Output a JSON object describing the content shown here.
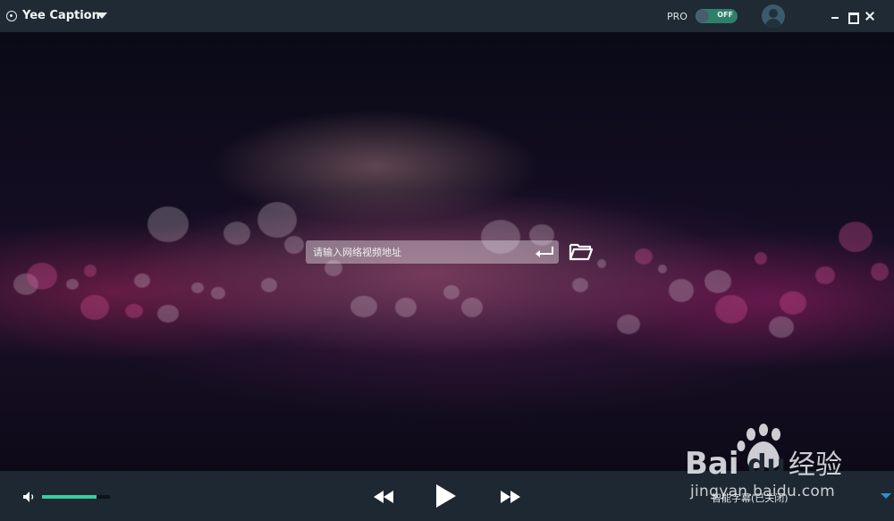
{
  "titlebar": {
    "app_title": "Yee Caption",
    "pro_label": "PRO",
    "toggle_label": "OFF",
    "toggle_state": "off"
  },
  "center": {
    "url_placeholder": "请输入网络视频地址"
  },
  "controls": {
    "volume_level": 0.8,
    "subtitle_status": "智能字幕(已关闭)"
  },
  "watermark": {
    "logo_text": "Bai du 经验",
    "url": "jingyan.baidu.com"
  },
  "icons": {
    "logo": "app-logo-icon",
    "menu": "dropdown-arrow-icon",
    "user": "user-avatar-icon",
    "minimize": "minimize-icon",
    "maximize": "maximize-icon",
    "close": "close-icon",
    "enter": "enter-icon",
    "folder": "open-folder-icon",
    "volume": "speaker-icon",
    "rewind": "rewind-icon",
    "play": "play-icon",
    "forward": "fast-forward-icon"
  },
  "colors": {
    "accent": "#35d0a0",
    "titlebar": "#1f2a34",
    "bottombar": "#1e2833"
  }
}
